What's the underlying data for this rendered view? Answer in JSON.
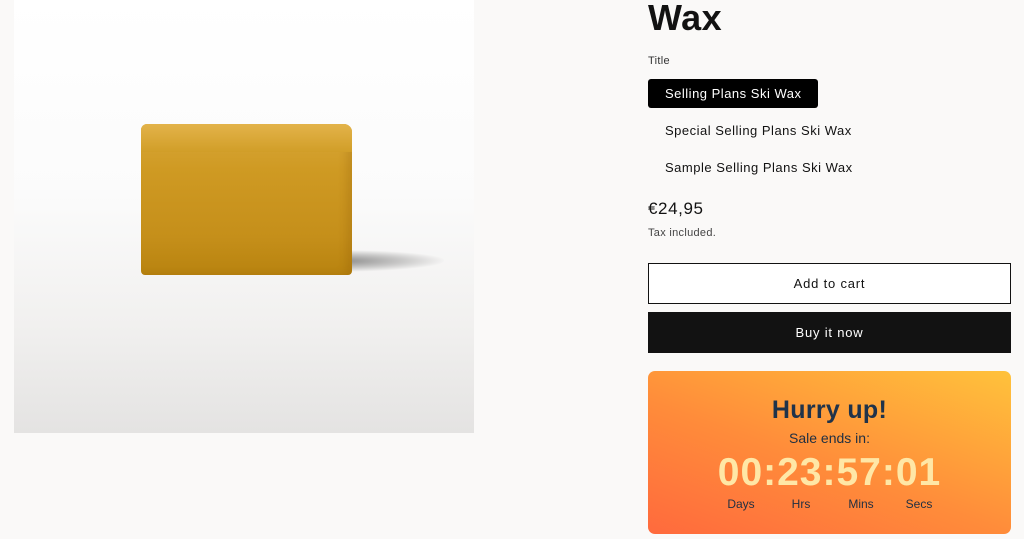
{
  "product": {
    "title": "Wax",
    "image_alt": "Yellow ski wax block"
  },
  "variant": {
    "label": "Title",
    "options": [
      {
        "label": "Selling Plans Ski Wax",
        "selected": true
      },
      {
        "label": "Special Selling Plans Ski Wax",
        "selected": false
      },
      {
        "label": "Sample Selling Plans Ski Wax",
        "selected": false
      }
    ]
  },
  "pricing": {
    "price": "€24,95",
    "tax_note": "Tax included."
  },
  "actions": {
    "add_to_cart": "Add to cart",
    "buy_now": "Buy it now"
  },
  "countdown": {
    "headline": "Hurry up!",
    "subtitle": "Sale ends in:",
    "display": "00:23:57:01",
    "days": "00",
    "hours": "23",
    "minutes": "57",
    "seconds": "01",
    "units": [
      "Days",
      "Hrs",
      "Mins",
      "Secs"
    ],
    "colors": {
      "gradient_start": "#ff6a3d",
      "gradient_end": "#ffc23b",
      "text": "#20334a",
      "digits": "#ffe7a6"
    }
  }
}
